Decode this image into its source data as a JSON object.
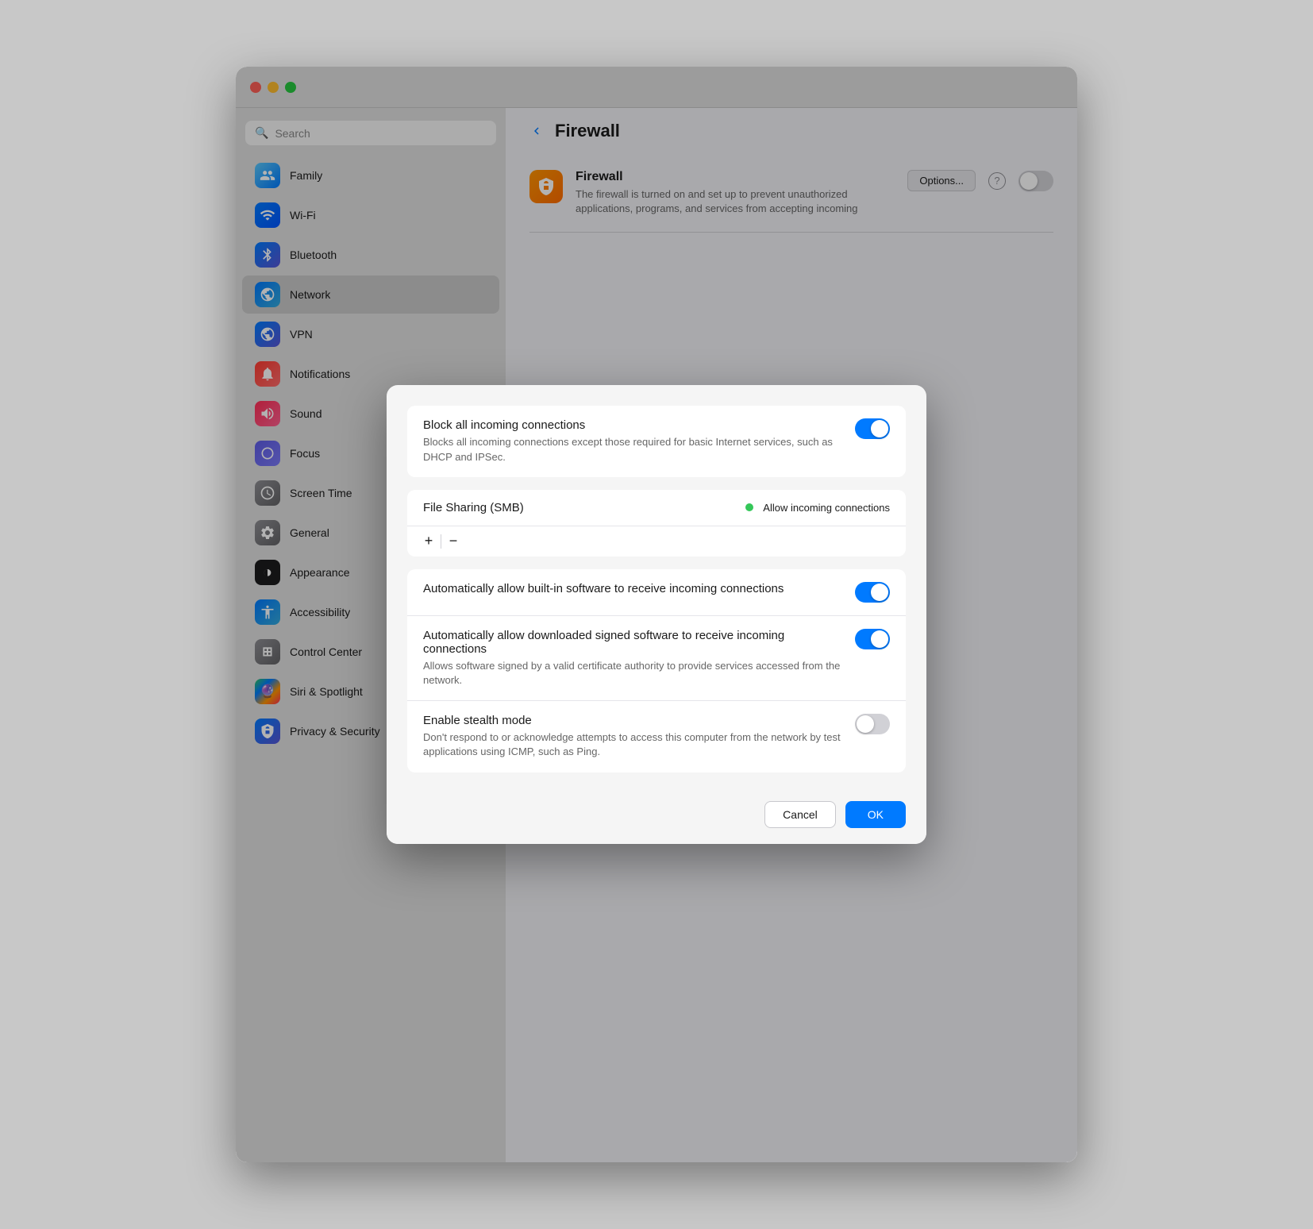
{
  "window": {
    "title": "Firewall"
  },
  "trafficLights": {
    "close": "close",
    "minimize": "minimize",
    "maximize": "maximize"
  },
  "sidebar": {
    "searchPlaceholder": "Search",
    "items": [
      {
        "id": "family",
        "label": "Family",
        "icon": "👨‍👩‍👧",
        "iconClass": "icon-family"
      },
      {
        "id": "wifi",
        "label": "Wi-Fi",
        "icon": "📶",
        "iconClass": "icon-wifi"
      },
      {
        "id": "bluetooth",
        "label": "Bluetooth",
        "icon": "✱",
        "iconClass": "icon-bluetooth"
      },
      {
        "id": "network",
        "label": "Network",
        "icon": "🌐",
        "iconClass": "icon-network"
      },
      {
        "id": "vpn",
        "label": "VPN",
        "icon": "🌐",
        "iconClass": "icon-vpn"
      },
      {
        "id": "notifications",
        "label": "Notifications",
        "icon": "🔔",
        "iconClass": "icon-notifications"
      },
      {
        "id": "sound",
        "label": "Sound",
        "icon": "🔊",
        "iconClass": "icon-sound"
      },
      {
        "id": "focus",
        "label": "Focus",
        "icon": "🌙",
        "iconClass": "icon-focus"
      },
      {
        "id": "screentime",
        "label": "Screen Time",
        "icon": "⏱",
        "iconClass": "icon-screentime"
      },
      {
        "id": "general",
        "label": "General",
        "icon": "⚙️",
        "iconClass": "icon-general"
      },
      {
        "id": "appearance",
        "label": "Appearance",
        "icon": "◑",
        "iconClass": "icon-appearance"
      },
      {
        "id": "accessibility",
        "label": "Accessibility",
        "icon": "♿",
        "iconClass": "icon-accessibility"
      },
      {
        "id": "controlcenter",
        "label": "Control Center",
        "icon": "⊞",
        "iconClass": "icon-controlcenter"
      },
      {
        "id": "siri",
        "label": "Siri & Spotlight",
        "icon": "◎",
        "iconClass": "icon-siri"
      },
      {
        "id": "privacy",
        "label": "Privacy & Security",
        "icon": "✋",
        "iconClass": "icon-privacy"
      }
    ]
  },
  "rightPanel": {
    "backLabel": "‹",
    "title": "Firewall",
    "firewallName": "Firewall",
    "firewallDesc": "The firewall is turned on and set up to prevent unauthorized applications, programs, and services from accepting incoming",
    "firewallToggleState": "off",
    "optionsLabel": "Options...",
    "helpLabel": "?"
  },
  "modal": {
    "sections": [
      {
        "rows": [
          {
            "title": "Block all incoming connections",
            "desc": "Blocks all incoming connections except those required for basic Internet services, such as DHCP and IPSec.",
            "toggleState": "on"
          }
        ]
      },
      {
        "fileSharing": {
          "name": "File Sharing (SMB)",
          "statusLabel": "Allow incoming connections",
          "statusDot": true
        },
        "addLabel": "+",
        "removeLabel": "−"
      },
      {
        "rows": [
          {
            "title": "Automatically allow built-in software to receive incoming connections",
            "desc": "",
            "toggleState": "on"
          },
          {
            "title": "Automatically allow downloaded signed software to receive incoming connections",
            "desc": "Allows software signed by a valid certificate authority to provide services accessed from the network.",
            "toggleState": "on"
          },
          {
            "title": "Enable stealth mode",
            "desc": "Don't respond to or acknowledge attempts to access this computer from the network by test applications using ICMP, such as Ping.",
            "toggleState": "off"
          }
        ]
      }
    ],
    "cancelLabel": "Cancel",
    "okLabel": "OK"
  }
}
